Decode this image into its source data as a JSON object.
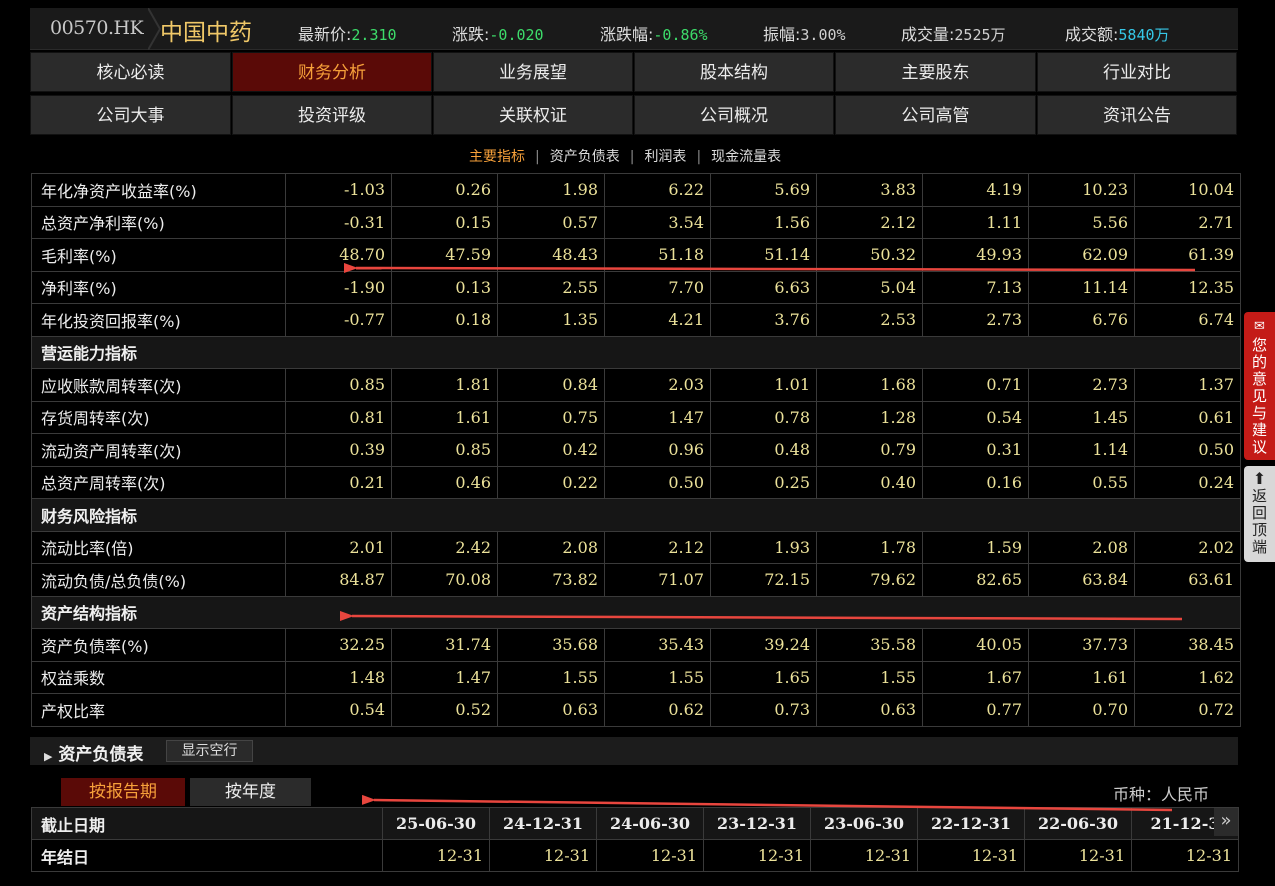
{
  "header": {
    "code": "00570.HK",
    "name": "中国中药",
    "stats": [
      {
        "label": "最新价:",
        "value": "2.310",
        "color": "#3ddc6a"
      },
      {
        "label": "涨跌:",
        "value": "-0.020",
        "color": "#3ddc6a"
      },
      {
        "label": "涨跌幅:",
        "value": "-0.86%",
        "color": "#3ddc6a"
      },
      {
        "label": "振幅:",
        "value": "3.00%",
        "color": "#cfcfcf"
      },
      {
        "label": "成交量:",
        "value": "2525万",
        "color": "#cfcfcf"
      },
      {
        "label": "成交额:",
        "value": "5840万",
        "color": "#36c8e8"
      }
    ]
  },
  "nav": {
    "row1": [
      "核心必读",
      "财务分析",
      "业务展望",
      "股本结构",
      "主要股东",
      "行业对比"
    ],
    "row2": [
      "公司大事",
      "投资评级",
      "关联权证",
      "公司概况",
      "公司高管",
      "资讯公告"
    ],
    "active": "财务分析"
  },
  "subtabs": [
    "主要指标",
    "资产负债表",
    "利润表",
    "现金流量表"
  ],
  "subtab_active": "主要指标",
  "metrics": [
    {
      "label": "年化净资产收益率(%)",
      "values": [
        "-1.03",
        "0.26",
        "1.98",
        "6.22",
        "5.69",
        "3.83",
        "4.19",
        "10.23",
        "10.04"
      ]
    },
    {
      "label": "总资产净利率(%)",
      "values": [
        "-0.31",
        "0.15",
        "0.57",
        "3.54",
        "1.56",
        "2.12",
        "1.11",
        "5.56",
        "2.71"
      ]
    },
    {
      "label": "毛利率(%)",
      "values": [
        "48.70",
        "47.59",
        "48.43",
        "51.18",
        "51.14",
        "50.32",
        "49.93",
        "62.09",
        "61.39"
      ]
    },
    {
      "label": "净利率(%)",
      "values": [
        "-1.90",
        "0.13",
        "2.55",
        "7.70",
        "6.63",
        "5.04",
        "7.13",
        "11.14",
        "12.35"
      ]
    },
    {
      "label": "年化投资回报率(%)",
      "values": [
        "-0.77",
        "0.18",
        "1.35",
        "4.21",
        "3.76",
        "2.53",
        "2.73",
        "6.76",
        "6.74"
      ]
    },
    {
      "section": "营运能力指标"
    },
    {
      "label": "应收账款周转率(次)",
      "values": [
        "0.85",
        "1.81",
        "0.84",
        "2.03",
        "1.01",
        "1.68",
        "0.71",
        "2.73",
        "1.37"
      ]
    },
    {
      "label": "存货周转率(次)",
      "values": [
        "0.81",
        "1.61",
        "0.75",
        "1.47",
        "0.78",
        "1.28",
        "0.54",
        "1.45",
        "0.61"
      ]
    },
    {
      "label": "流动资产周转率(次)",
      "values": [
        "0.39",
        "0.85",
        "0.42",
        "0.96",
        "0.48",
        "0.79",
        "0.31",
        "1.14",
        "0.50"
      ]
    },
    {
      "label": "总资产周转率(次)",
      "values": [
        "0.21",
        "0.46",
        "0.22",
        "0.50",
        "0.25",
        "0.40",
        "0.16",
        "0.55",
        "0.24"
      ]
    },
    {
      "section": "财务风险指标"
    },
    {
      "label": "流动比率(倍)",
      "values": [
        "2.01",
        "2.42",
        "2.08",
        "2.12",
        "1.93",
        "1.78",
        "1.59",
        "2.08",
        "2.02"
      ]
    },
    {
      "label": "流动负债/总负债(%)",
      "values": [
        "84.87",
        "70.08",
        "73.82",
        "71.07",
        "72.15",
        "79.62",
        "82.65",
        "63.84",
        "63.61"
      ]
    },
    {
      "section": "资产结构指标"
    },
    {
      "label": "资产负债率(%)",
      "values": [
        "32.25",
        "31.74",
        "35.68",
        "35.43",
        "39.24",
        "35.58",
        "40.05",
        "37.73",
        "38.45"
      ]
    },
    {
      "label": "权益乘数",
      "values": [
        "1.48",
        "1.47",
        "1.55",
        "1.55",
        "1.65",
        "1.55",
        "1.67",
        "1.61",
        "1.62"
      ]
    },
    {
      "label": "产权比率",
      "values": [
        "0.54",
        "0.52",
        "0.63",
        "0.62",
        "0.73",
        "0.63",
        "0.77",
        "0.70",
        "0.72"
      ]
    }
  ],
  "side": {
    "feedback": "您的意见与建议",
    "back_top": "返回顶端"
  },
  "balance": {
    "title": "资产负债表",
    "show_empty": "显示空行",
    "period_tabs": [
      "按报告期",
      "按年度"
    ],
    "period_active": "按报告期",
    "currency": "币种：人民币",
    "header_label": "截止日期",
    "dates": [
      "25-06-30",
      "24-12-31",
      "24-06-30",
      "23-12-31",
      "23-06-30",
      "22-12-31",
      "22-06-30",
      "21-12-3"
    ],
    "row_label": "年结日",
    "row_values": [
      "12-31",
      "12-31",
      "12-31",
      "12-31",
      "12-31",
      "12-31",
      "12-31",
      "12-31"
    ],
    "more": "»"
  },
  "colors": {
    "accent": "#f6a03a",
    "active_bg": "#5a0a07",
    "value": "#ece29a",
    "arrow": "#e8463e"
  }
}
